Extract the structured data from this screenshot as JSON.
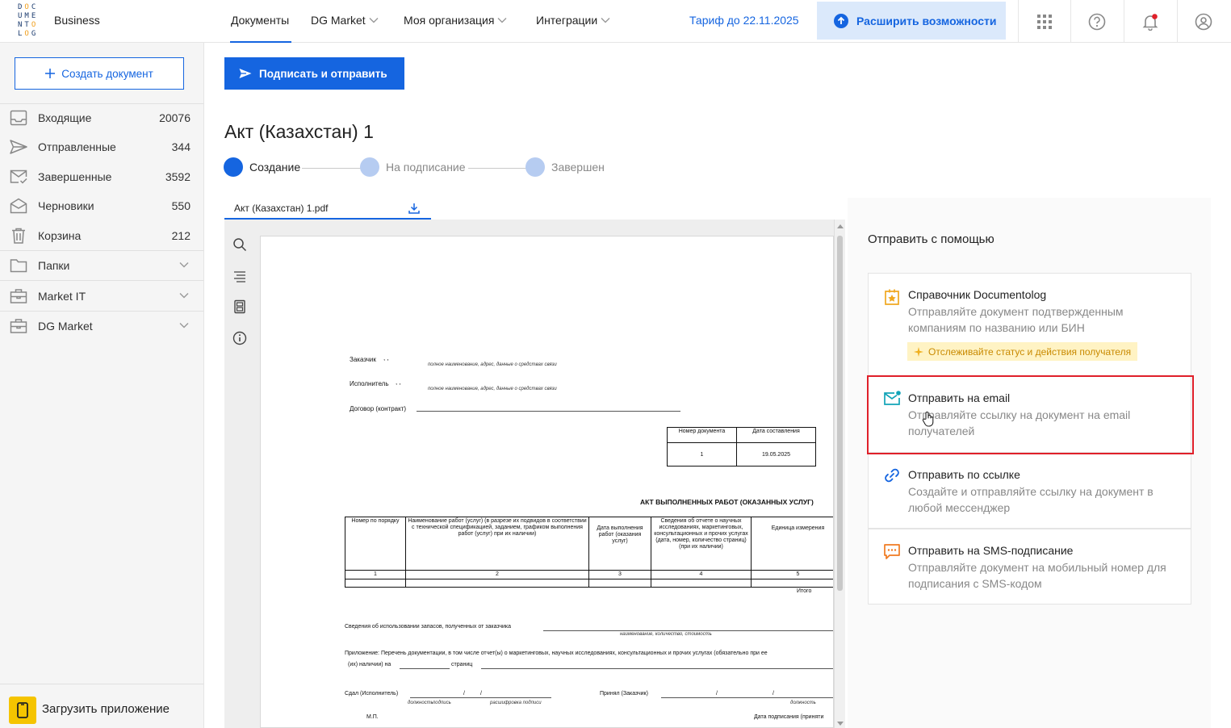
{
  "app": {
    "logo_letters": [
      "D",
      "O",
      "C",
      "U",
      "M",
      "E",
      "N",
      "T",
      "O",
      "L",
      "O",
      "G"
    ],
    "edition": "Business"
  },
  "header": {
    "nav": [
      {
        "label": "Документы",
        "has_menu": false,
        "active": true
      },
      {
        "label": "DG Market",
        "has_menu": true
      },
      {
        "label": "Моя организация",
        "has_menu": true
      },
      {
        "label": "Интеграции",
        "has_menu": true
      }
    ],
    "tariff": "Тариф до 22.11.2025",
    "expand_label": "Расширить возможности",
    "icons": [
      "apps-grid-icon",
      "help-icon",
      "bell-icon",
      "user-icon"
    ]
  },
  "sidebar": {
    "create_label": "Создать документ",
    "items": [
      {
        "label": "Входящие",
        "count": "20076",
        "icon": "inbox-icon"
      },
      {
        "label": "Отправленные",
        "count": "344",
        "icon": "send-icon"
      },
      {
        "label": "Завершенные",
        "count": "3592",
        "icon": "envelope-check-icon"
      },
      {
        "label": "Черновики",
        "count": "550",
        "icon": "draft-envelope-icon"
      },
      {
        "label": "Корзина",
        "count": "212",
        "icon": "trash-icon"
      },
      {
        "label": "Папки",
        "count": "",
        "icon": "folder-icon"
      },
      {
        "label": "Market IT",
        "count": "",
        "icon": "briefcase-icon"
      },
      {
        "label": "DG Market",
        "count": "",
        "icon": "briefcase-icon"
      }
    ],
    "app_download": "Загрузить приложение"
  },
  "main": {
    "sign_send_label": "Подписать и отправить",
    "doc_title": "Акт (Казахстан) 1",
    "steps": [
      {
        "label": "Создание",
        "state": "active"
      },
      {
        "label": "На подписание",
        "state": "pending"
      },
      {
        "label": "Завершен",
        "state": "pending"
      }
    ],
    "file_tab": "Акт (Казахстан) 1.pdf"
  },
  "document": {
    "customer": "Заказчик",
    "customer_marks": ", ,",
    "executor": "Исполнитель",
    "executor_marks": ", ,",
    "party_hint": "полное наименование, адрес, данные о средствах связи",
    "contract": "Договор (контракт)",
    "number_header": "Номер документа",
    "date_header": "Дата составления",
    "number": "1",
    "date": "19.05.2025",
    "act_title": "АКТ ВЫПОЛНЕННЫХ РАБОТ (ОКАЗАННЫХ УСЛУГ)",
    "table_headers": [
      "Номер по порядку",
      "Наименование работ (услуг) (в разрезе их подвидов в соответствии с технической спецификацией, заданием, графиком выполнения работ (услуг) при их наличии)",
      "Дата выполнения работ (оказания услуг)",
      "Сведения об отчете о научных исследованиях, маркетинговых, консультационных и прочих услугах (дата, номер, количество страниц) (при их наличии)",
      "Единица измерения"
    ],
    "column_numbers": [
      "1",
      "2",
      "3",
      "4",
      "5"
    ],
    "total": "Итого",
    "reserves": "Сведения об использовании запасов, полученных от заказчика",
    "reserves_hint": "наименование, количество, стоимость",
    "appendix_line1": "Приложение: Перечень документации, в том числе отчет(ы) о маркетинговых, научных исследованиях, консультационных и прочих услугах (обязательно при ее",
    "appendix_line2_a": "(их) наличии) на",
    "appendix_line2_b": "страниц",
    "handed": "Сдал (Исполнитель)",
    "accepted": "Принял (Заказчик)",
    "position": "должность",
    "signature": "подпись",
    "decoding": "расшифровка подписи",
    "position2": "должность",
    "stamp": "М.П.",
    "sign_date": "Дата подписания (приняти"
  },
  "send_panel": {
    "title": "Отправить с помощью",
    "options": [
      {
        "title": "Справочник Documentolog",
        "desc": "Отправляйте документ подтвержденным компаниям по названию или БИН",
        "icon": "directory-star-icon",
        "badge": "Отслеживайте статус и действия получателя"
      },
      {
        "title": "Отправить на email",
        "desc": "Отправляйте ссылку на документ на email получателей",
        "icon": "email-icon",
        "highlighted": true
      },
      {
        "title": "Отправить по ссылке",
        "desc": "Создайте и отправляйте ссылку на документ в любой мессенджер",
        "icon": "link-icon"
      },
      {
        "title": "Отправить на SMS-подписание",
        "desc": "Отправляйте документ на мобильный номер для подписания с SMS-кодом",
        "icon": "sms-icon"
      }
    ]
  },
  "colors": {
    "accent": "#1565e0",
    "highlight": "#e0202a",
    "badge_bg": "#fff3c4",
    "badge_text": "#c98a00"
  }
}
